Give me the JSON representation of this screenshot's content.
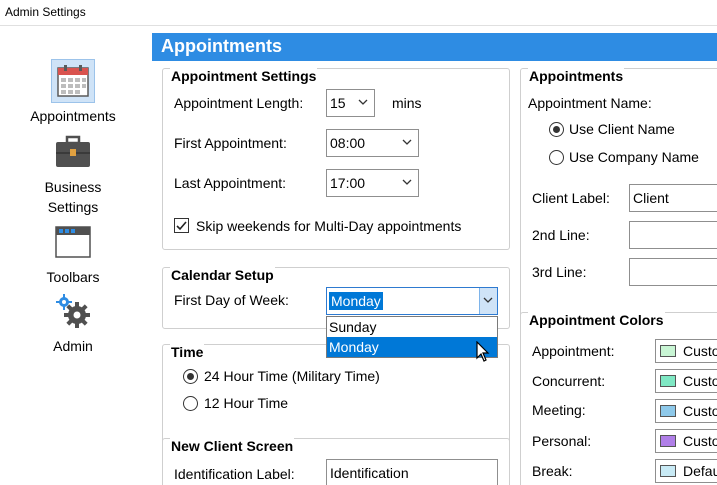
{
  "window": {
    "title": "Admin Settings"
  },
  "sidebar": {
    "items": [
      {
        "label": "Appointments"
      },
      {
        "label_line1": "Business",
        "label_line2": "Settings"
      },
      {
        "label": "Toolbars"
      },
      {
        "label": "Admin"
      }
    ]
  },
  "header": {
    "title": "Appointments"
  },
  "appointment_settings": {
    "title": "Appointment Settings",
    "length_label": "Appointment Length:",
    "length_value": "15",
    "length_unit": "mins",
    "first_label": "First Appointment:",
    "first_value": "08:00",
    "last_label": "Last Appointment:",
    "last_value": "17:00",
    "skip_weekends_label": "Skip weekends for Multi-Day appointments",
    "skip_weekends_checked": true
  },
  "calendar_setup": {
    "title": "Calendar Setup",
    "first_day_label": "First Day of Week:",
    "first_day_value": "Monday",
    "options": [
      "Sunday",
      "Monday"
    ]
  },
  "time": {
    "title": "Time",
    "option_24": "24 Hour Time (Military Time)",
    "option_12": "12 Hour Time",
    "selected": "24"
  },
  "new_client_screen": {
    "title": "New Client Screen",
    "id_label": "Identification Label:",
    "id_value": "Identification"
  },
  "appointments_panel": {
    "title": "Appointments",
    "name_label": "Appointment Name:",
    "use_client_name": "Use Client Name",
    "use_company_name": "Use Company Name",
    "client_label_label": "Client Label:",
    "client_label_value": "Client",
    "second_line_label": "2nd Line:",
    "third_line_label": "3rd Line:"
  },
  "appointment_colors": {
    "title": "Appointment Colors",
    "items": [
      {
        "label": "Appointment:",
        "value": "Custom",
        "color": "#c8f5d4"
      },
      {
        "label": "Concurrent:",
        "value": "Custom",
        "color": "#7fe8c4"
      },
      {
        "label": "Meeting:",
        "value": "Custom",
        "color": "#8ec9ea"
      },
      {
        "label": "Personal:",
        "value": "Custom",
        "color": "#b07fe8"
      },
      {
        "label": "Break:",
        "value": "Default",
        "color": "#c8eaf5"
      }
    ]
  }
}
